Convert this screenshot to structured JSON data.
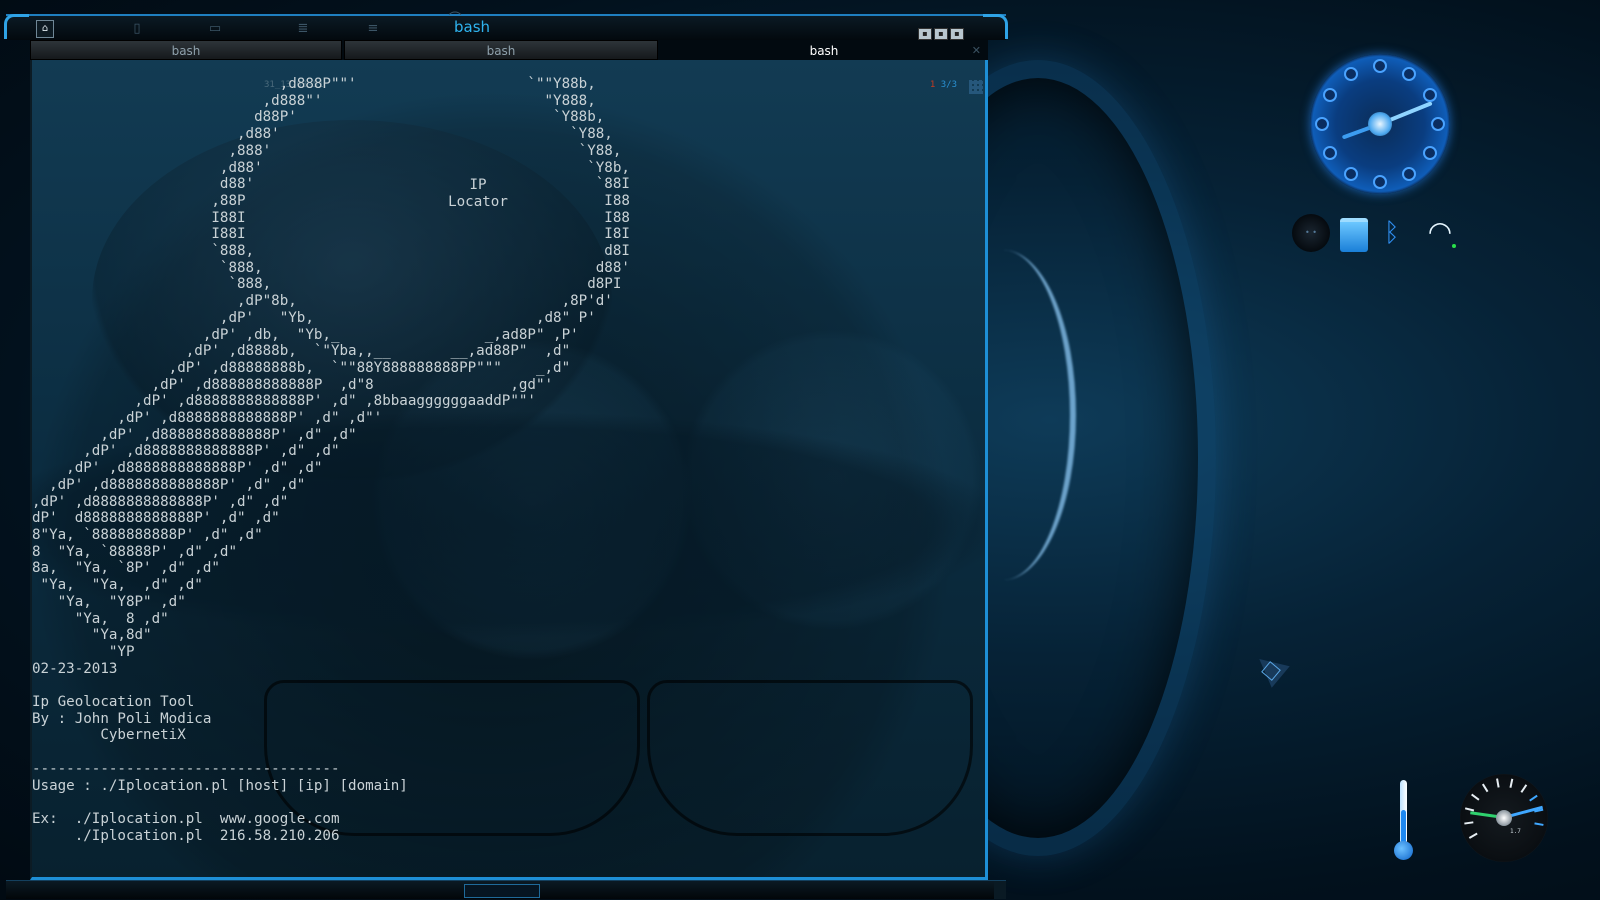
{
  "window": {
    "title": "bash",
    "launchers": [
      "home-launcher",
      "files-launcher",
      "terminal-launcher",
      "docs-launcher",
      "stack-launcher",
      "hat-launcher"
    ],
    "buttons": [
      "minimize",
      "maximize",
      "close"
    ]
  },
  "tabs": [
    {
      "label": "bash",
      "active": false
    },
    {
      "label": "bash",
      "active": false
    },
    {
      "label": "bash",
      "active": true
    }
  ],
  "terminal": {
    "stamp": "31_13-03-51",
    "indicator_left": "1",
    "indicator_right": "3/3",
    "banner_title_line1": "IP",
    "banner_title_line2": "Locator",
    "date": "02-23-2013",
    "tool_name": "Ip Geolocation Tool",
    "author": "By : John Poli Modica",
    "team": "CybernetiX",
    "separator": "------------------------------------",
    "usage": "Usage : ./Iplocation.pl [host] [ip] [domain]",
    "example1": "Ex:  ./Iplocation.pl  www.google.com",
    "example2": "     ./Iplocation.pl  216.58.210.206",
    "ascii_art": [
      "                             ,d888P\"\"'                    `\"\"Y88b,",
      "                           ,d888\"'                          \"Y888,",
      "                          d88P'                              `Y88b,",
      "                        ,d88'                                  `Y88,",
      "                       ,888'                                    `Y88,",
      "                      ,d88'                                      `Y8b,",
      "                      d88'                                        `88I",
      "                     ,88P                                          I88",
      "                     I88I                                          I88",
      "                     I88I                                          I8I",
      "                     `888,                                         d8I",
      "                      `888,                                       d88'",
      "                       `888,                                     d8PI",
      "                        ,dP\"8b,                               ,8P'd'",
      "                      ,dP'   \"Yb,                          ,d8\" P'",
      "                    ,dP' ,db,  \"Yb,_                 _,ad8P\" ,P'",
      "                  ,dP' ,d8888b,  `\"Yba,,__       __,ad88P\"  ,d\"",
      "                ,dP' ,d88888888b,  `\"\"88Y888888888PP\"\"\"    _,d\"",
      "              ,dP' ,d888888888888P  ,d\"8                ,gd\"'",
      "            ,dP' ,d8888888888888P' ,d\" ,8bbaaggggggaaddP\"\"'",
      "          ,dP' ,d8888888888888P' ,d\" ,d\"'",
      "        ,dP' ,d8888888888888P' ,d\" ,d\"",
      "      ,dP' ,d8888888888888P' ,d\" ,d\"",
      "    ,dP' ,d8888888888888P' ,d\" ,d\"",
      "  ,dP' ,d8888888888888P' ,d\" ,d\"",
      ",dP' ,d8888888888888P' ,d\" ,d\"",
      "dP'  d8888888888888P' ,d\" ,d\"",
      "8\"Ya, `8888888888P' ,d\" ,d\"",
      "8  \"Ya, `88888P' ,d\" ,d\"",
      "8a,  \"Ya, `8P' ,d\" ,d\"",
      " \"Ya,  \"Ya,  ,d\" ,d\"",
      "   \"Ya,  \"Y8P\" ,d\"",
      "     \"Ya,  8 ,d\"",
      "       \"Ya,8d\"",
      "         \"YP"
    ]
  },
  "widgets": {
    "gauge_readout": "1.7"
  },
  "colors": {
    "accent": "#1e8fd6",
    "title_text": "#2fb4f0",
    "terminal_text": "#c9d2d6"
  }
}
